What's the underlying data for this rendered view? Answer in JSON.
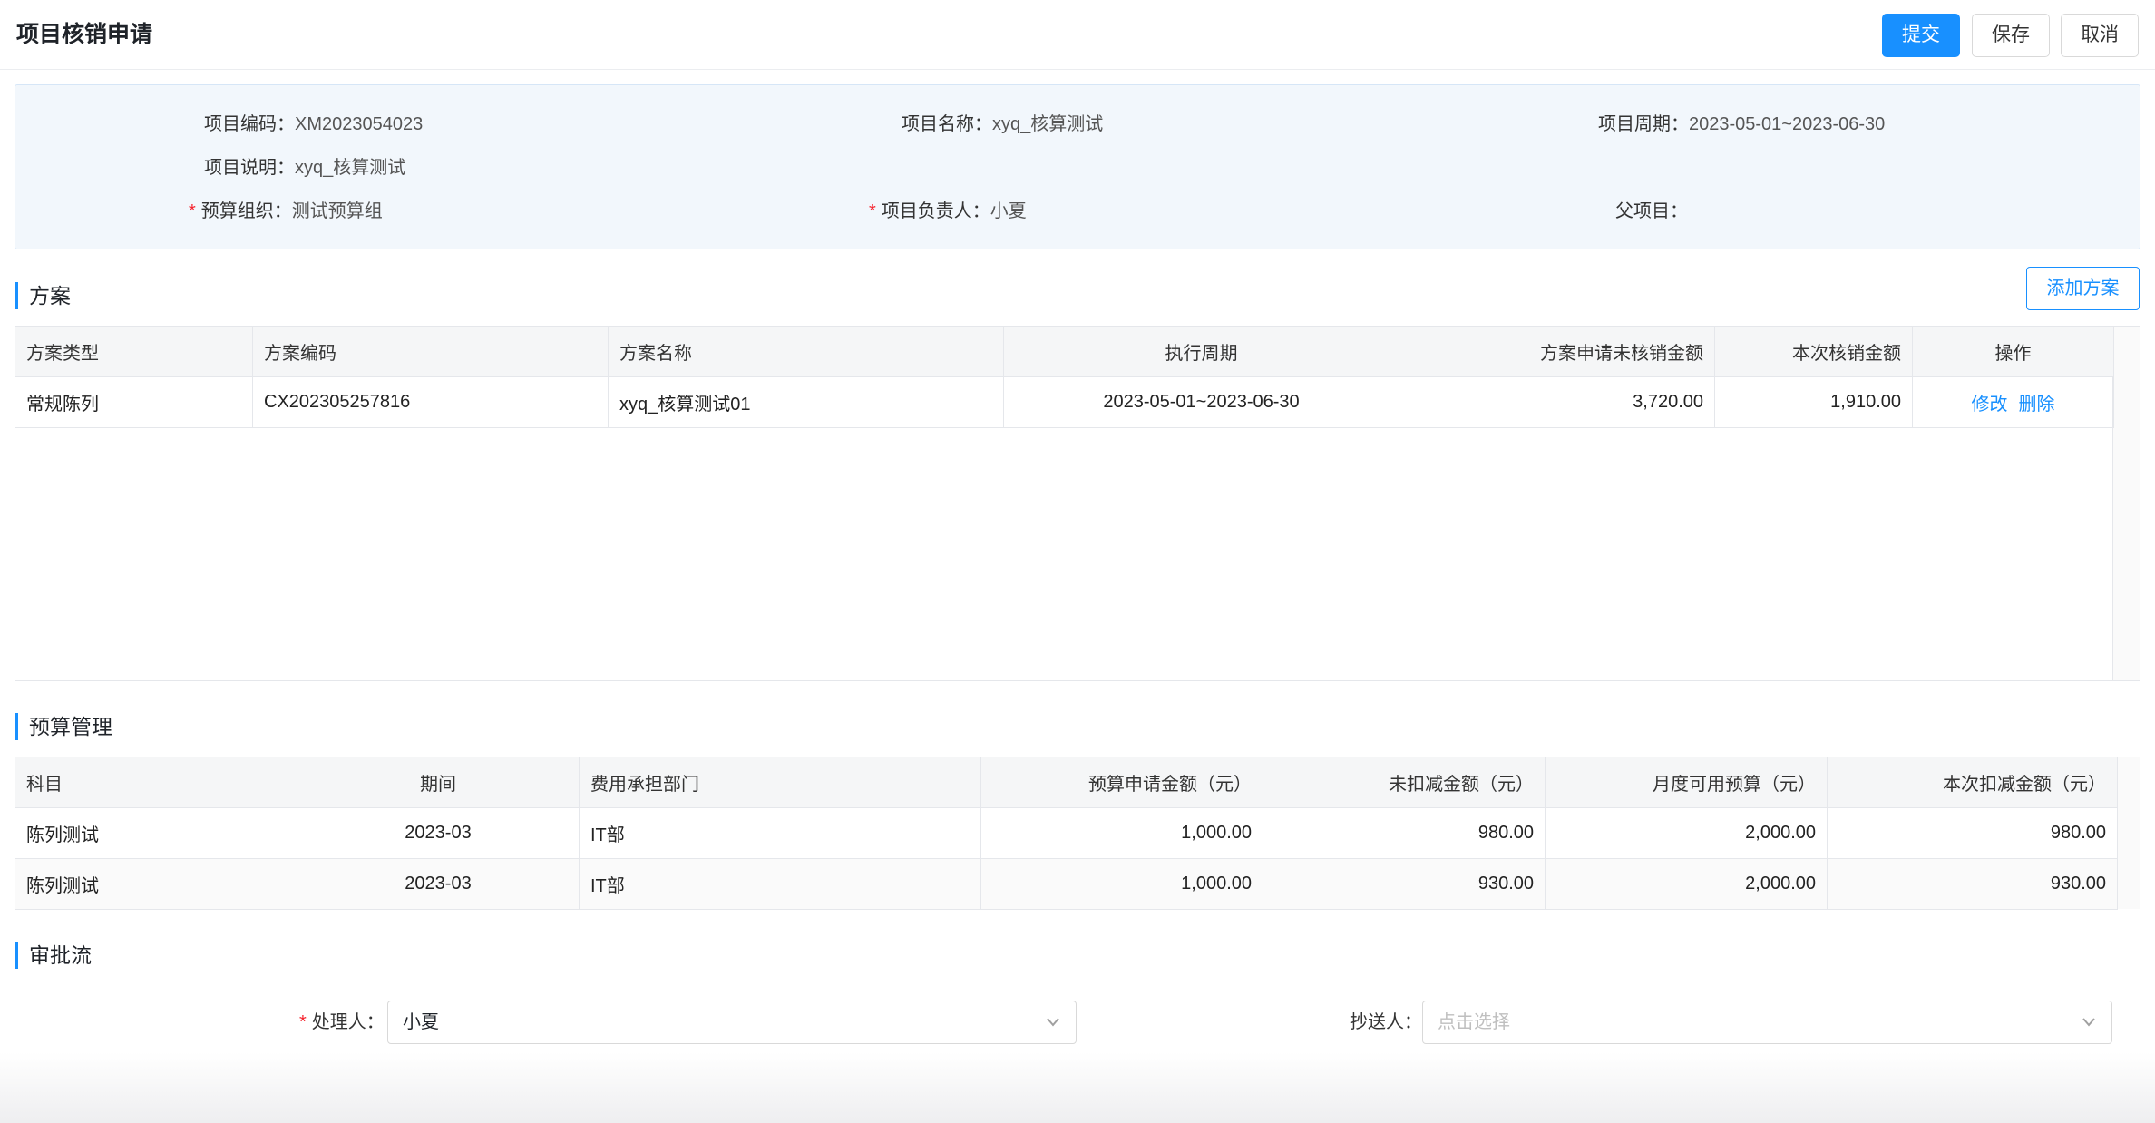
{
  "header": {
    "title": "项目核销申请",
    "submit_label": "提交",
    "save_label": "保存",
    "cancel_label": "取消"
  },
  "info": {
    "project_code": {
      "label": "项目编码：",
      "value": "XM2023054023"
    },
    "project_name": {
      "label": "项目名称：",
      "value": "xyq_核算测试"
    },
    "project_period": {
      "label": "项目周期：",
      "value": "2023-05-01~2023-06-30"
    },
    "project_desc": {
      "label": "项目说明：",
      "value": "xyq_核算测试"
    },
    "budget_org": {
      "label": "预算组织：",
      "value": "测试预算组"
    },
    "project_owner": {
      "label": "项目负责人：",
      "value": "小夏"
    },
    "parent_project": {
      "label": "父项目：",
      "value": ""
    }
  },
  "plan": {
    "section_title": "方案",
    "add_label": "添加方案",
    "columns": [
      "方案类型",
      "方案编码",
      "方案名称",
      "执行周期",
      "方案申请未核销金额",
      "本次核销金额",
      "操作"
    ],
    "rows": [
      {
        "type": "常规陈列",
        "code": "CX202305257816",
        "name": "xyq_核算测试01",
        "period": "2023-05-01~2023-06-30",
        "unverified": "3,720.00",
        "current": "1,910.00",
        "edit": "修改",
        "delete": "删除"
      }
    ]
  },
  "budget": {
    "section_title": "预算管理",
    "columns": [
      "科目",
      "期间",
      "费用承担部门",
      "预算申请金额（元）",
      "未扣减金额（元）",
      "月度可用预算（元）",
      "本次扣减金额（元）"
    ],
    "rows": [
      {
        "subject": "陈列测试",
        "period": "2023-03",
        "dept": "IT部",
        "apply": "1,000.00",
        "undeducted": "980.00",
        "monthly": "2,000.00",
        "deduct": "980.00"
      },
      {
        "subject": "陈列测试",
        "period": "2023-03",
        "dept": "IT部",
        "apply": "1,000.00",
        "undeducted": "930.00",
        "monthly": "2,000.00",
        "deduct": "930.00"
      }
    ]
  },
  "approval": {
    "section_title": "审批流",
    "handler_label": "处理人：",
    "handler_value": "小夏",
    "cc_label": "抄送人：",
    "cc_placeholder": "点击选择"
  },
  "colors": {
    "primary": "#1890ff",
    "required": "#f5222d",
    "panel_bg": "#f2f7fc"
  }
}
